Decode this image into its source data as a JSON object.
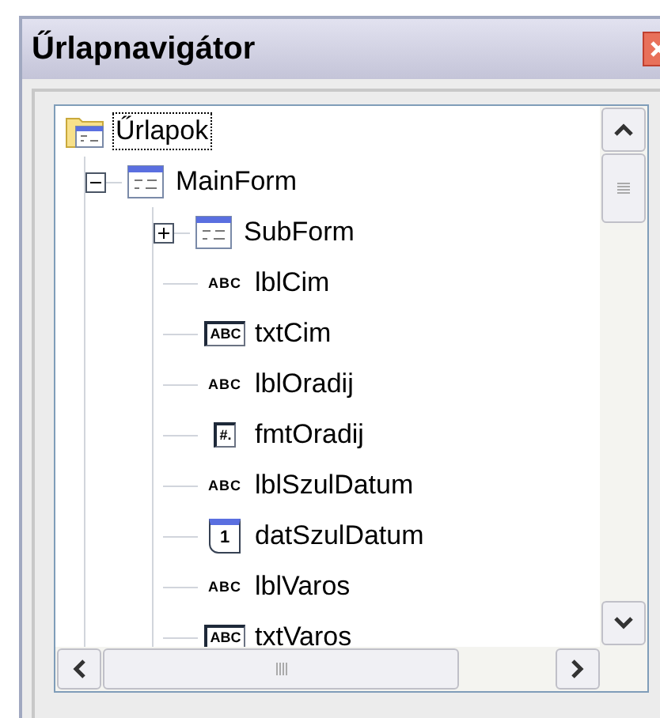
{
  "window": {
    "title": "Űrlapnavigátor"
  },
  "tree": [
    {
      "label": "Űrlapok",
      "kind": "folder",
      "selected": true,
      "expanded": true,
      "children": [
        {
          "label": "MainForm",
          "kind": "form",
          "selected": false,
          "expanded": true,
          "children": [
            {
              "label": "SubForm",
              "kind": "form",
              "selected": false,
              "expanded": false
            },
            {
              "label": "lblCim",
              "kind": "label",
              "icon_text": "ABC",
              "selected": false
            },
            {
              "label": "txtCim",
              "kind": "textbox",
              "icon_text": "ABC",
              "selected": false
            },
            {
              "label": "lblOradij",
              "kind": "label",
              "icon_text": "ABC",
              "selected": false
            },
            {
              "label": "fmtOradij",
              "kind": "formatted",
              "icon_text": "#.",
              "selected": false
            },
            {
              "label": "lblSzulDatum",
              "kind": "label",
              "icon_text": "ABC",
              "selected": false
            },
            {
              "label": "datSzulDatum",
              "kind": "date",
              "icon_text": "1",
              "selected": false
            },
            {
              "label": "lblVaros",
              "kind": "label",
              "icon_text": "ABC",
              "selected": false
            },
            {
              "label": "txtVaros",
              "kind": "textbox",
              "icon_text": "ABC",
              "selected": false
            }
          ]
        }
      ]
    }
  ]
}
